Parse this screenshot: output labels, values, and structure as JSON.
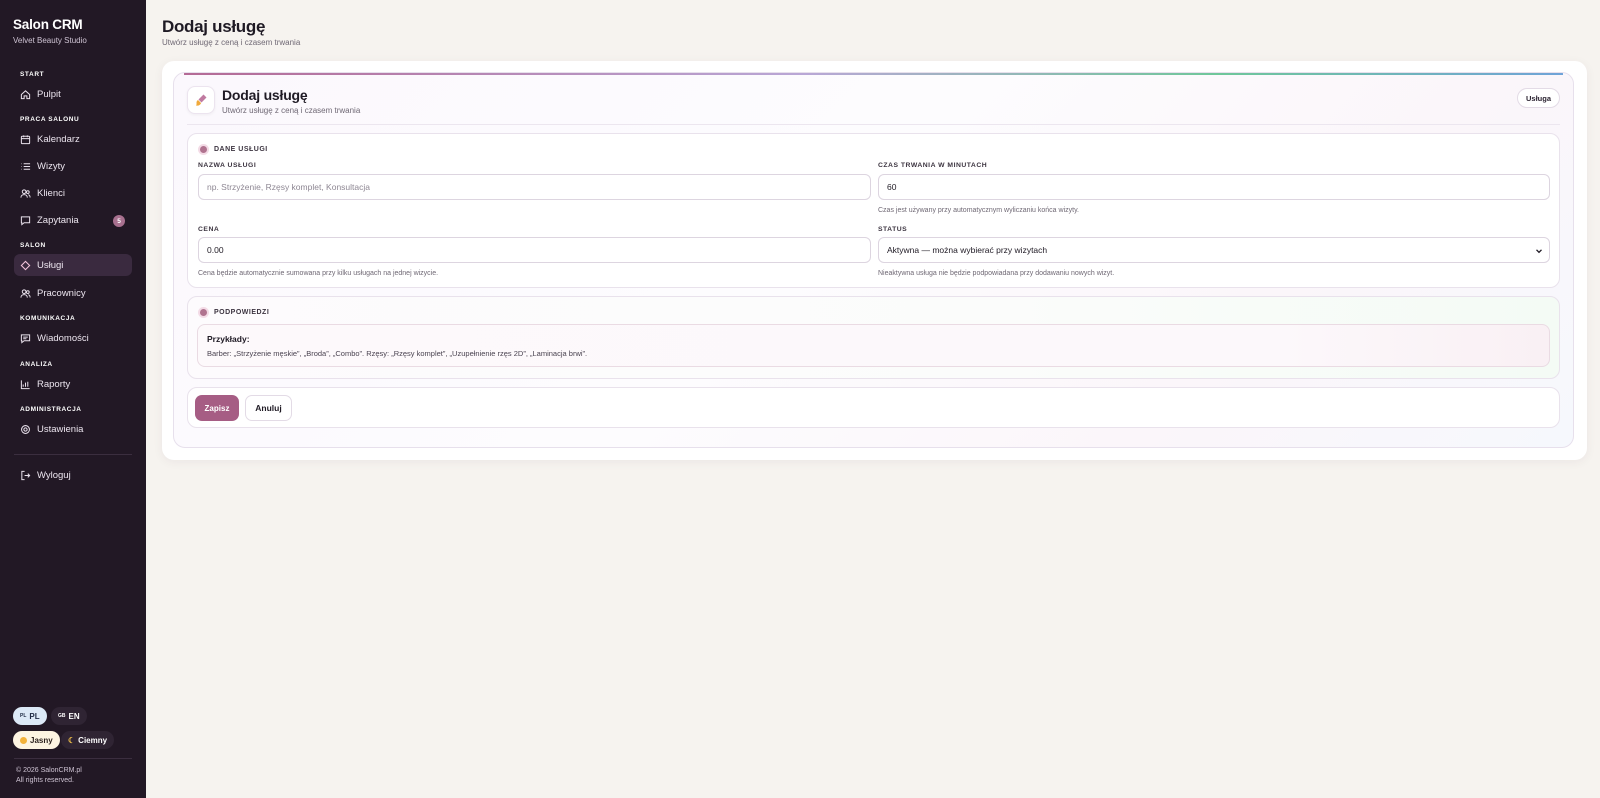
{
  "sidebar": {
    "brand": {
      "title": "Salon CRM",
      "subtitle": "Velvet Beauty Studio"
    },
    "sections": {
      "start": "START",
      "praca": "PRACA SALONU",
      "salon": "SALON",
      "komunikacja": "KOMUNIKACJA",
      "analiza": "ANALIZA",
      "admin": "ADMINISTRACJA"
    },
    "items": {
      "pulpit": "Pulpit",
      "kalendarz": "Kalendarz",
      "wizyty": "Wizyty",
      "klienci": "Klienci",
      "zapytania": "Zapytania",
      "zapytania_badge": "5",
      "uslugi": "Usługi",
      "pracownicy": "Pracownicy",
      "wiadomosci": "Wiadomości",
      "raporty": "Raporty",
      "ustawienia": "Ustawienia",
      "wyloguj": "Wyloguj"
    },
    "lang": {
      "pl_flag": "PL",
      "pl": "PL",
      "en_flag": "GB",
      "en": "EN"
    },
    "theme": {
      "light": "Jasny",
      "dark": "Ciemny"
    },
    "copyright": {
      "line1": "© 2026 SalonCRM.pl",
      "line2": "All rights reserved."
    }
  },
  "header": {
    "title": "Dodaj usługę",
    "subtitle": "Utwórz usługę z ceną i czasem trwania"
  },
  "card": {
    "title": "Dodaj usługę",
    "subtitle": "Utwórz usługę z ceną i czasem trwania",
    "badge": "Usługa",
    "icon": "brush-icon"
  },
  "form": {
    "section_label": "DANE USŁUGI",
    "name": {
      "label": "NAZWA USŁUGI",
      "placeholder": "np. Strzyżenie, Rzęsy komplet, Konsultacja",
      "value": ""
    },
    "duration": {
      "label": "CZAS TRWANIA W MINUTACH",
      "value": "60",
      "help": "Czas jest używany przy automatycznym wyliczaniu końca wizyty."
    },
    "price": {
      "label": "CENA",
      "value": "0.00",
      "help": "Cena będzie automatycznie sumowana przy kilku usługach na jednej wizycie."
    },
    "status": {
      "label": "STATUS",
      "value": "Aktywna — można wybierać przy wizytach",
      "help": "Nieaktywna usługa nie będzie podpowiadana przy dodawaniu nowych wizyt."
    }
  },
  "hints": {
    "section_label": "PODPOWIEDZI",
    "title": "Przykłady:",
    "text": "Barber: „Strzyżenie męskie”, „Broda”, „Combo”. Rzęsy: „Rzęsy komplet”, „Uzupełnienie rzęs 2D”, „Laminacja brwi”."
  },
  "actions": {
    "save": "Zapisz",
    "cancel": "Anuluj"
  },
  "colors": {
    "sidebar_bg": "#221825",
    "accent": "#a65d84",
    "page_bg": "#f6f3ef"
  }
}
